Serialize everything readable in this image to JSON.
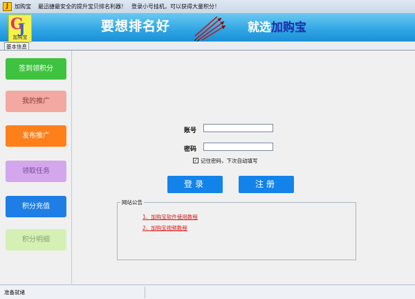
{
  "titlebar": {
    "app_icon": "J",
    "app_name": "加购宝",
    "tagline": "最迅捷最安全的提升宝贝排名利器！",
    "promo": "登录小号挂机，可以获得大量积分！"
  },
  "banner": {
    "logo_caption": "加购宝",
    "slogan_left": "要想排名好",
    "slogan_right_prefix": "就选",
    "slogan_right_brand": "加购宝"
  },
  "tabs": [
    {
      "label": "基本信息",
      "active": true
    }
  ],
  "sidebar": {
    "items": [
      {
        "label": "签到领积分",
        "color": "#3fc23f"
      },
      {
        "label": "我的推广",
        "color": "#f3a9a1"
      },
      {
        "label": "发布推广",
        "color": "#ff7f1a"
      },
      {
        "label": "领取任务",
        "color": "#d4a6ec"
      },
      {
        "label": "积分充值",
        "color": "#1e7ee6"
      },
      {
        "label": "积分明细",
        "color": "#d4f0b5"
      }
    ]
  },
  "login": {
    "account_label": "账号",
    "account_value": "",
    "password_label": "密码",
    "password_value": "",
    "remember_checked": true,
    "remember_label": "记住密码，下次自动填写",
    "login_button": "登录",
    "register_button": "注册"
  },
  "notice": {
    "title": "网站公告",
    "links": [
      "1、加购宝软件使用教程",
      "2、加购宝视频教程"
    ]
  },
  "status": {
    "text": "准备就绪"
  }
}
